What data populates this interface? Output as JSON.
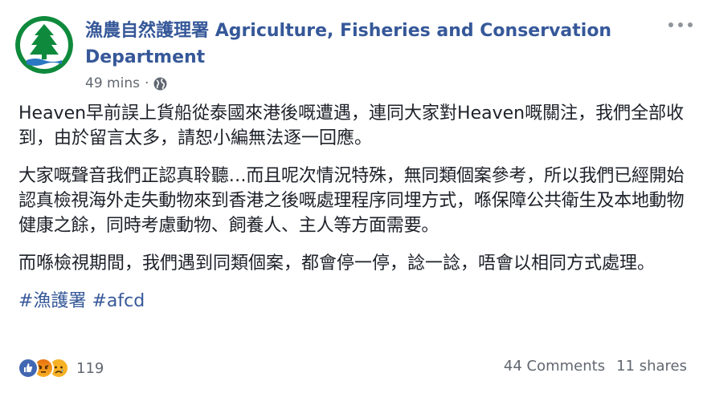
{
  "post": {
    "page_name_zh": "漁農自然護理署",
    "page_name_en": "Agriculture, Fisheries and Conservation Department",
    "timestamp": "49 mins",
    "separator": "·",
    "privacy_icon": "globe-icon",
    "menu_icon": "more-options-icon",
    "avatar_icon": "pine-tree-logo",
    "paragraphs": [
      "Heaven早前誤上貨船從泰國來港後嘅遭遇，連同大家對Heaven嘅關注，我們全部收到，由於留言太多，請恕小編無法逐一回應。",
      "大家嘅聲音我們正認真聆聽…而且呢次情況特殊，無同類個案參考，所以我們已經開始認真檢視海外走失動物來到香港之後嘅處理程序同埋方式，喺保障公共衛生及本地動物健康之餘，同時考慮動物、飼養人、主人等方面需要。",
      "而喺檢視期間，我們遇到同類個案，都會停一停，諗一諗，唔會以相同方式處理。"
    ],
    "hashtags": [
      "#漁護署",
      "#afcd"
    ]
  },
  "footer": {
    "reaction_icons": [
      "like-icon",
      "angry-icon",
      "sad-icon"
    ],
    "reaction_count": "119",
    "comments": "44 Comments",
    "shares": "11 shares"
  },
  "colors": {
    "link": "#365899",
    "meta_text": "#616770",
    "body_text": "#1d2129",
    "logo_green": "#0f8a3c"
  }
}
